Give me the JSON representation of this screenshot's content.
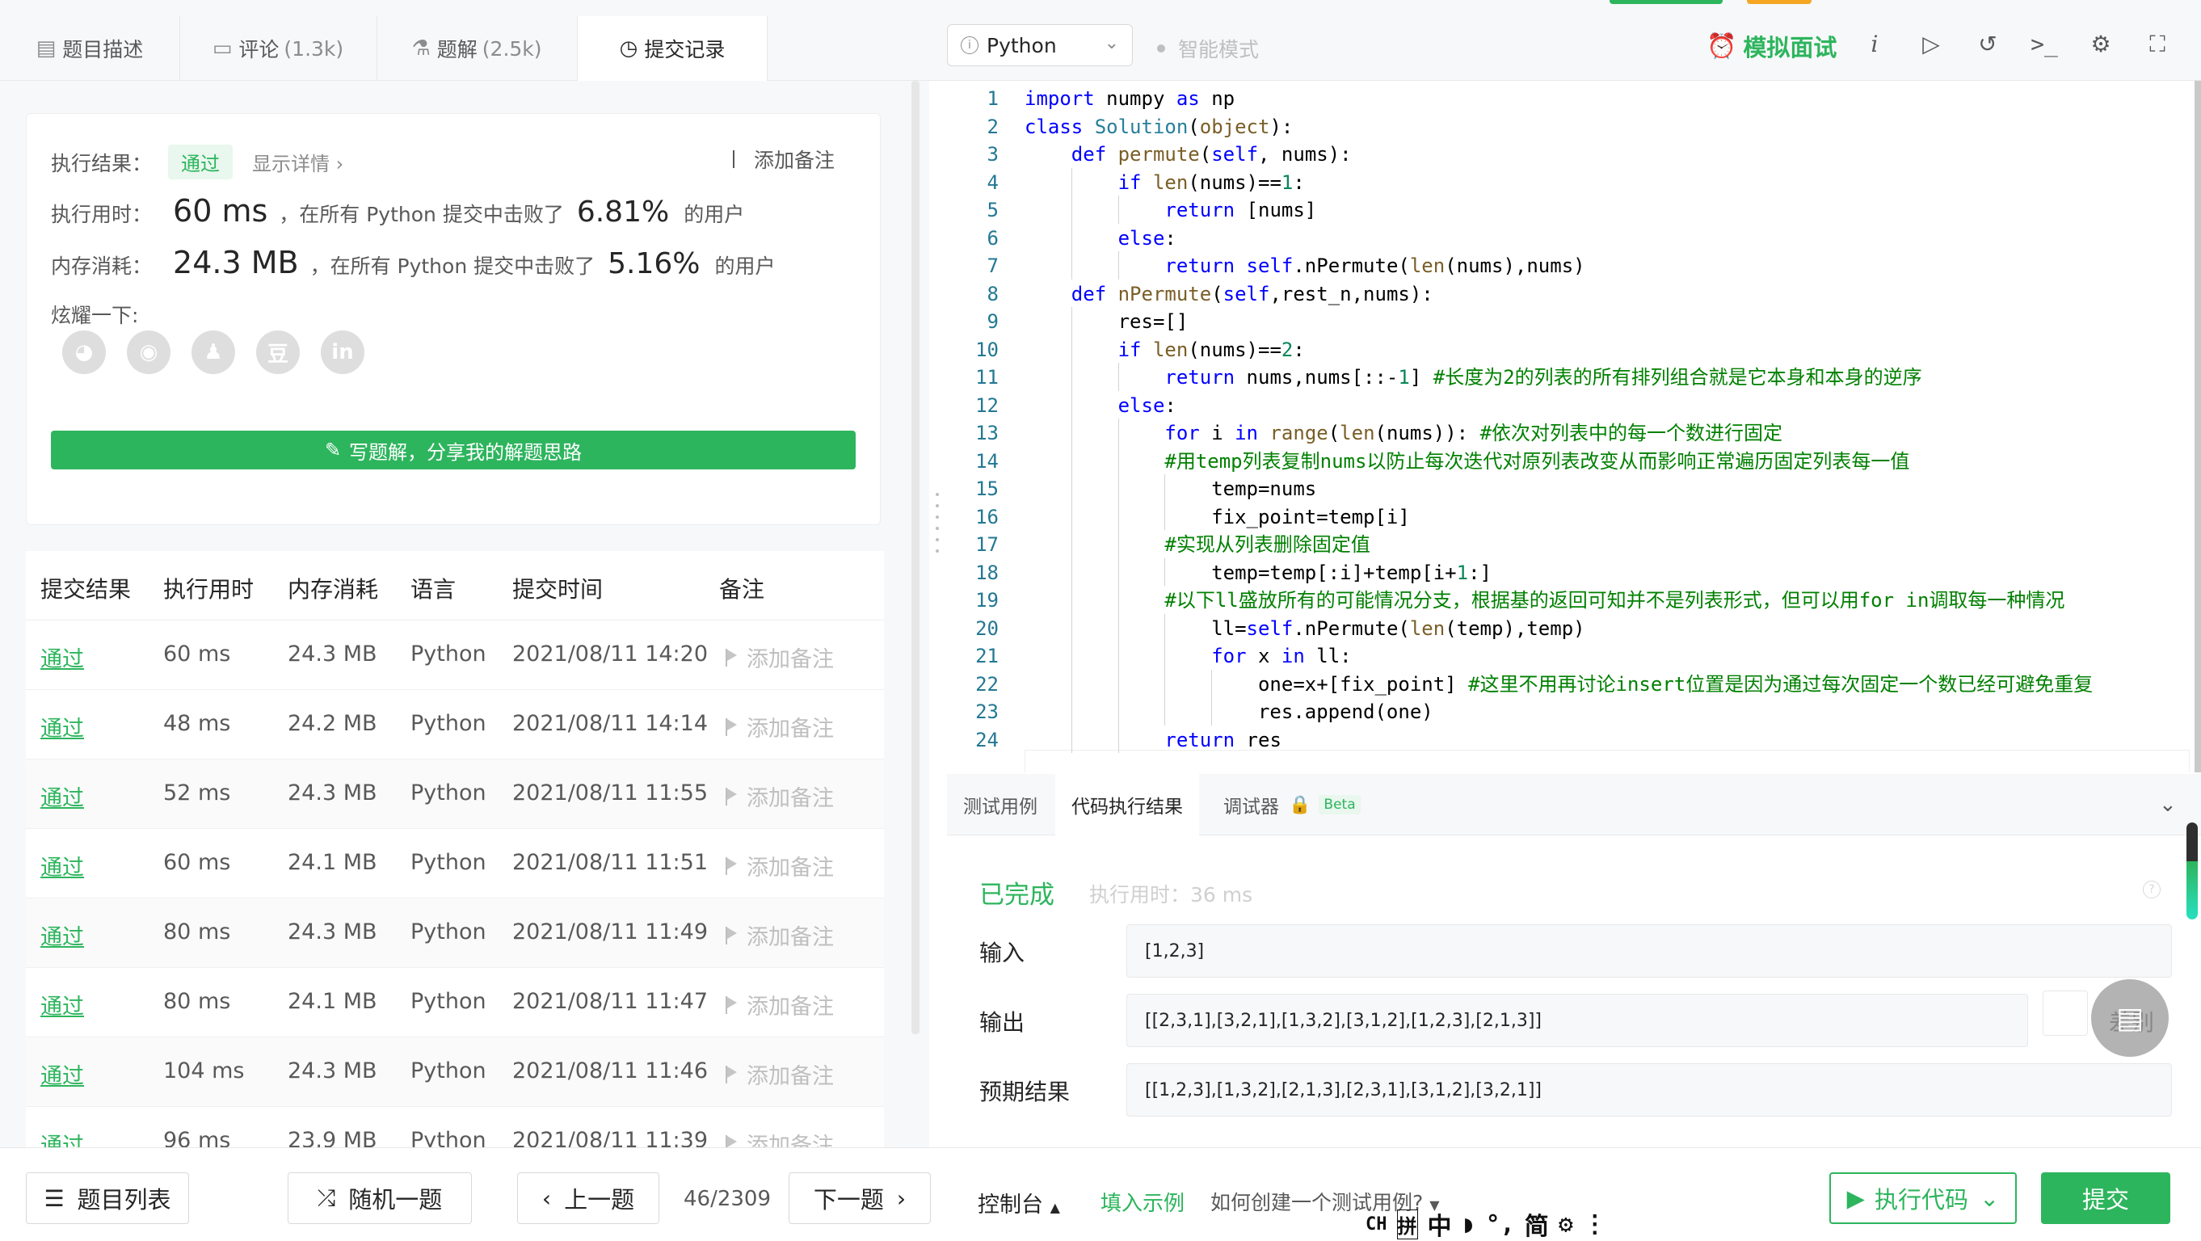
{
  "tabs": [
    {
      "icon": "▤",
      "label": "题目描述",
      "count": ""
    },
    {
      "icon": "▭",
      "label": "评论",
      "count": "(1.3k)"
    },
    {
      "icon": "⚗",
      "label": "题解",
      "count": "(2.5k)"
    },
    {
      "icon": "◷",
      "label": "提交记录",
      "count": ""
    }
  ],
  "editor_toolbar": {
    "language": "Python",
    "smart_mode": "智能模式",
    "mock_interview": "模拟面试"
  },
  "result_card": {
    "result_label": "执行结果：",
    "result_badge": "通过",
    "show_detail": "显示详情 ›",
    "add_note": "添加备注",
    "time_label": "执行用时：",
    "time_value": "60 ms",
    "time_text": "，在所有 Python 提交中击败了",
    "time_pct": "6.81%",
    "users": "的用户",
    "mem_label": "内存消耗：",
    "mem_value": "24.3 MB",
    "mem_text": "，在所有 Python 提交中击败了",
    "mem_pct": "5.16%",
    "share_label": "炫耀一下:",
    "write_button": "写题解，分享我的解题思路"
  },
  "table": {
    "headers": [
      "提交结果",
      "执行用时",
      "内存消耗",
      "语言",
      "提交时间",
      "备注"
    ],
    "rows": [
      {
        "result": "通过",
        "time": "60 ms",
        "memory": "24.3 MB",
        "lang": "Python",
        "submitted": "2021/08/11 14:20",
        "note": "添加备注"
      },
      {
        "result": "通过",
        "time": "48 ms",
        "memory": "24.2 MB",
        "lang": "Python",
        "submitted": "2021/08/11 14:14",
        "note": "添加备注"
      },
      {
        "result": "通过",
        "time": "52 ms",
        "memory": "24.3 MB",
        "lang": "Python",
        "submitted": "2021/08/11 11:55",
        "note": "添加备注"
      },
      {
        "result": "通过",
        "time": "60 ms",
        "memory": "24.1 MB",
        "lang": "Python",
        "submitted": "2021/08/11 11:51",
        "note": "添加备注"
      },
      {
        "result": "通过",
        "time": "80 ms",
        "memory": "24.3 MB",
        "lang": "Python",
        "submitted": "2021/08/11 11:49",
        "note": "添加备注"
      },
      {
        "result": "通过",
        "time": "80 ms",
        "memory": "24.1 MB",
        "lang": "Python",
        "submitted": "2021/08/11 11:47",
        "note": "添加备注"
      },
      {
        "result": "通过",
        "time": "104 ms",
        "memory": "24.3 MB",
        "lang": "Python",
        "submitted": "2021/08/11 11:46",
        "note": "添加备注"
      },
      {
        "result": "通过",
        "time": "96 ms",
        "memory": "23.9 MB",
        "lang": "Python",
        "submitted": "2021/08/11 11:39",
        "note": "添加备注"
      }
    ]
  },
  "code_lines": [
    "import numpy as np",
    "class Solution(object):",
    "    def permute(self, nums):",
    "        if len(nums)==1:",
    "            return [nums]",
    "        else:",
    "            return self.nPermute(len(nums),nums)",
    "    def nPermute(self,rest_n,nums):",
    "        res=[]",
    "        if len(nums)==2:",
    "            return nums,nums[::-1] #长度为2的列表的所有排列组合就是它本身和本身的逆序",
    "        else:",
    "            for i in range(len(nums)): #依次对列表中的每一个数进行固定",
    "            #用temp列表复制nums以防止每次迭代对原列表改变从而影响正常遍历固定列表每一值",
    "                temp=nums",
    "                fix_point=temp[i]",
    "            #实现从列表删除固定值",
    "                temp=temp[:i]+temp[i+1:]",
    "            #以下ll盛放所有的可能情况分支，根据基的返回可知并不是列表形式，但可以用for in调取每一种情况",
    "                ll=self.nPermute(len(temp),temp)",
    "                for x in ll:",
    "                    one=x+[fix_point] #这里不用再讨论insert位置是因为通过每次固定一个数已经可避免重复",
    "                    res.append(one)",
    "            return res"
  ],
  "result_panel": {
    "tabs": [
      "测试用例",
      "代码执行结果",
      "调试器"
    ],
    "beta": "Beta",
    "status": "已完成",
    "exec_time": "执行用时：36 ms",
    "input_label": "输入",
    "input_value": "[1,2,3]",
    "output_label": "输出",
    "output_value": "[[2,3,1],[3,2,1],[1,3,2],[3,1,2],[1,2,3],[2,1,3]]",
    "diff_label": "差别",
    "expected_label": "预期结果",
    "expected_value": "[[1,2,3],[1,3,2],[2,1,3],[2,3,1],[3,1,2],[3,2,1]]"
  },
  "bottom": {
    "problem_list": "题目列表",
    "random": "随机一题",
    "prev": "上一题",
    "page": "46/2309",
    "next": "下一题",
    "console": "控制台",
    "fill_example": "填入示例",
    "how_to": "如何创建一个测试用例?",
    "ime": [
      "CH",
      "拼",
      "中",
      "◗",
      "°,",
      "简",
      "⚙",
      "⋮"
    ],
    "run": "执行代码",
    "submit": "提交"
  },
  "colors": {
    "accent": "#2db55d",
    "orange": "#f5a623"
  }
}
